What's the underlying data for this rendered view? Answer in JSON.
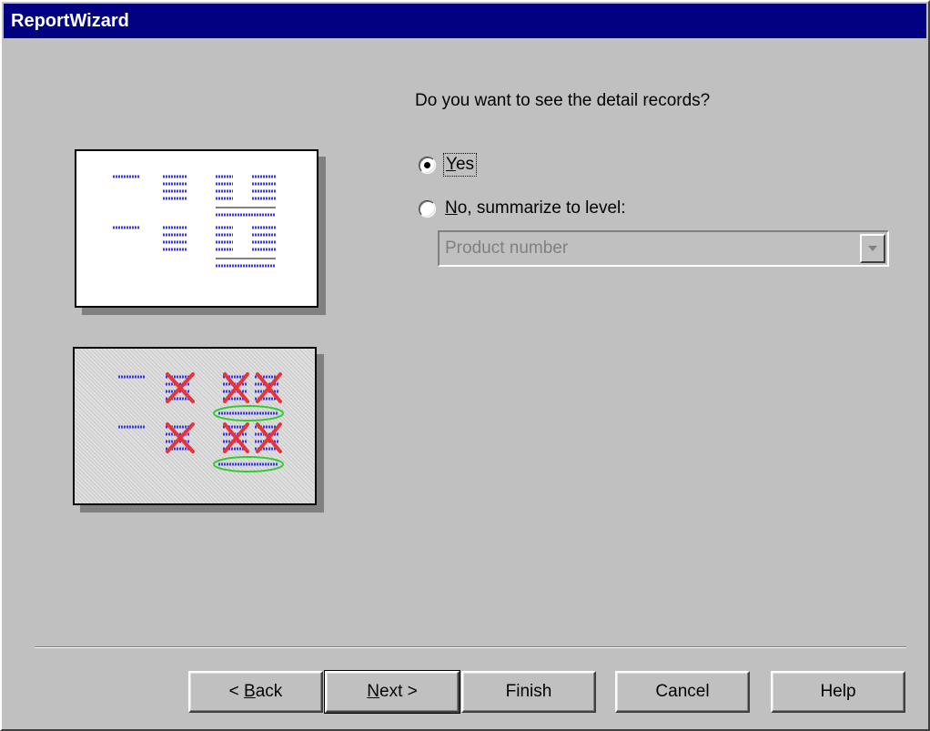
{
  "window": {
    "title": "ReportWizard"
  },
  "question": "Do you want to see the detail records?",
  "options": {
    "yes": {
      "label_mnemonic": "Y",
      "label_rest": "es",
      "selected": true
    },
    "no": {
      "label_mnemonic": "N",
      "label_rest": "o, summarize to level:",
      "selected": false
    }
  },
  "level_select": {
    "value": "Product number",
    "enabled": false
  },
  "buttons": {
    "back": {
      "prefix": "< ",
      "mnemonic": "B",
      "rest": "ack"
    },
    "next": {
      "mnemonic": "N",
      "rest": "ext >"
    },
    "finish": "Finish",
    "cancel": "Cancel",
    "help": "Help"
  },
  "colors": {
    "title_bar": "#000080",
    "dialog_face": "#c0c0c0",
    "preview_lines": "#3a3ae8",
    "preview_cross": "#e8333a",
    "preview_circle": "#33cc33"
  }
}
